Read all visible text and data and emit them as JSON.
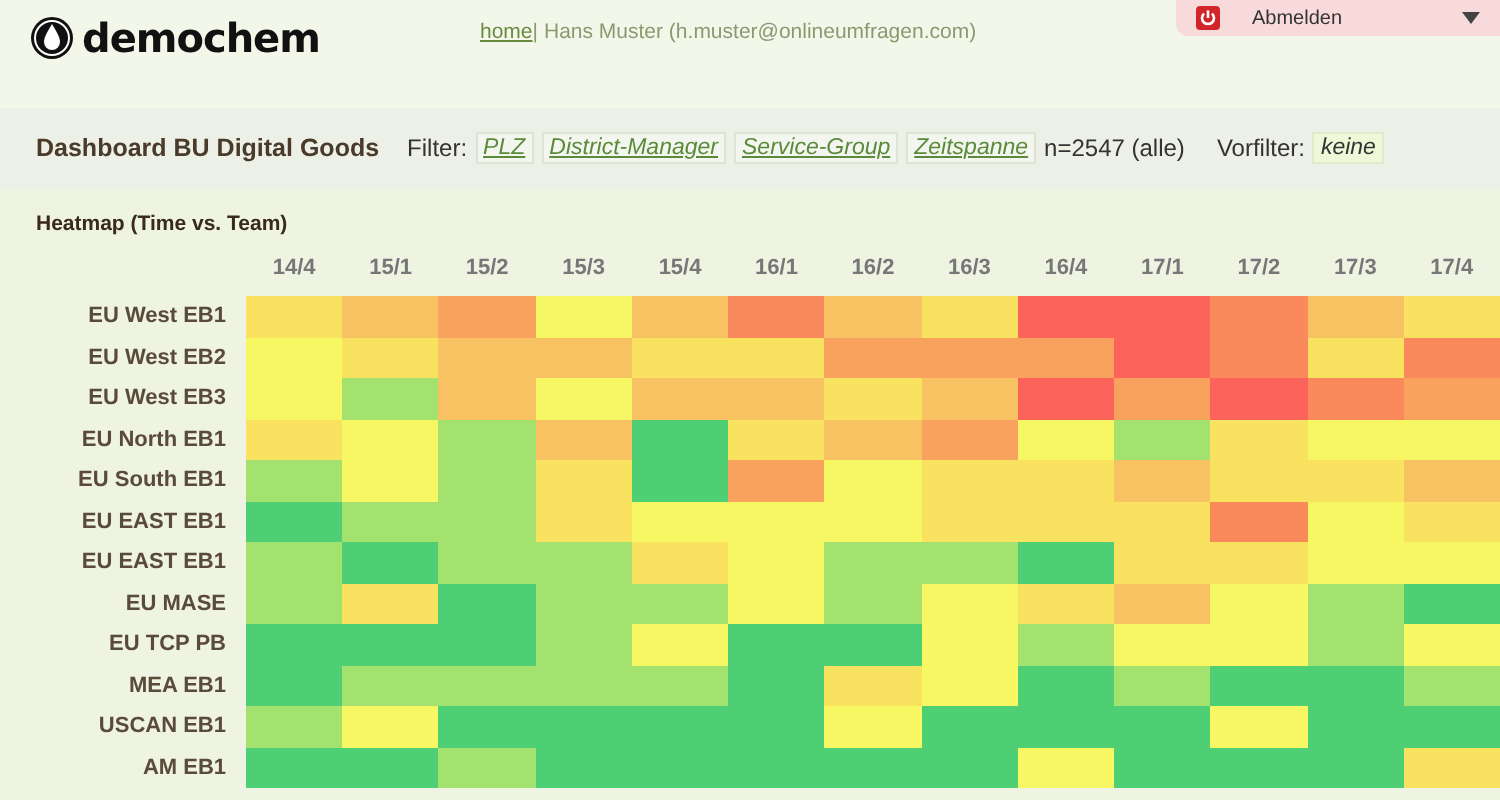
{
  "header": {
    "logo": "demochem",
    "home_link": "home",
    "separator": "|",
    "user": "Hans Muster (h.muster@onlineumfragen.com)",
    "logout": "Abmelden"
  },
  "dashboard": {
    "title": "Dashboard BU Digital Goods",
    "filter_label": "Filter:",
    "filters": [
      "PLZ",
      "District-Manager",
      "Service-Group",
      "Zeitspanne"
    ],
    "count": "n=2547 (alle)",
    "prefilter_label": "Vorfilter:",
    "prefilter": "keine"
  },
  "heatmap": {
    "title": "Heatmap (Time vs. Team)",
    "columns": [
      "14/4",
      "15/1",
      "15/2",
      "15/3",
      "15/4",
      "16/1",
      "16/2",
      "16/3",
      "16/4",
      "17/1",
      "17/2",
      "17/3",
      "17/4"
    ],
    "rows": [
      {
        "label": "EU West EB1",
        "cells": [
          {
            "color": "#f8e25f"
          },
          {
            "color": "#f8c262"
          },
          {
            "color": "#f8a25e"
          },
          {
            "color": "#f7f764"
          },
          {
            "color": "#f8c262"
          },
          {
            "color": "#fa8a5c"
          },
          {
            "color": "#f8c262"
          },
          {
            "color": "#f8e25f"
          },
          {
            "color": "#fc635a"
          },
          {
            "color": "#fc635a"
          },
          {
            "color": "#fa8a5c"
          },
          {
            "color": "#f8c262"
          },
          {
            "color": "#f8e25f"
          }
        ]
      },
      {
        "label": "EU West EB2",
        "cells": [
          {
            "color": "#f7f764"
          },
          {
            "color": "#f8e25f"
          },
          {
            "color": "#f8c262"
          },
          {
            "color": "#f8c262"
          },
          {
            "color": "#f8e25f"
          },
          {
            "color": "#f8e25f"
          },
          {
            "color": "#f8a25e"
          },
          {
            "color": "#f8a25e"
          },
          {
            "color": "#f8a25e"
          },
          {
            "color": "#fc635a"
          },
          {
            "color": "#fa8a5c"
          },
          {
            "color": "#f8e25f"
          },
          {
            "color": "#fa8a5c"
          }
        ]
      },
      {
        "label": "EU West EB3",
        "cells": [
          {
            "color": "#f7f764"
          },
          {
            "color": "#a3e26e"
          },
          {
            "color": "#f8c262"
          },
          {
            "color": "#f7f764"
          },
          {
            "color": "#f8c262"
          },
          {
            "color": "#f8c262"
          },
          {
            "color": "#f8e25f"
          },
          {
            "color": "#f8c262"
          },
          {
            "color": "#fc635a"
          },
          {
            "color": "#f8a25e"
          },
          {
            "color": "#fc635a"
          },
          {
            "color": "#fa8a5c"
          },
          {
            "color": "#f8a25e"
          }
        ]
      },
      {
        "label": "EU North EB1",
        "cells": [
          {
            "color": "#f8e25f"
          },
          {
            "color": "#f7f764"
          },
          {
            "color": "#a3e26e"
          },
          {
            "color": "#f8c262"
          },
          {
            "color": "#4ecf73"
          },
          {
            "color": "#f8e25f"
          },
          {
            "color": "#f8c262"
          },
          {
            "color": "#f8a25e"
          },
          {
            "color": "#f7f764"
          },
          {
            "color": "#a3e26e"
          },
          {
            "color": "#f8e25f"
          },
          {
            "color": "#f7f764"
          },
          {
            "color": "#f7f764"
          }
        ]
      },
      {
        "label": "EU South EB1",
        "cells": [
          {
            "color": "#a3e26e"
          },
          {
            "color": "#f7f764"
          },
          {
            "color": "#a3e26e"
          },
          {
            "color": "#f8e25f"
          },
          {
            "color": "#4ecf73"
          },
          {
            "color": "#f8a25e"
          },
          {
            "color": "#f7f764"
          },
          {
            "color": "#f8e25f"
          },
          {
            "color": "#f8e25f"
          },
          {
            "color": "#f8c262"
          },
          {
            "color": "#f8e25f"
          },
          {
            "color": "#f8e25f"
          },
          {
            "color": "#f8c262"
          }
        ]
      },
      {
        "label": "EU EAST EB1",
        "cells": [
          {
            "color": "#4ecf73"
          },
          {
            "color": "#a3e26e"
          },
          {
            "color": "#a3e26e"
          },
          {
            "color": "#f8e25f"
          },
          {
            "color": "#f7f764"
          },
          {
            "color": "#f7f764"
          },
          {
            "color": "#f7f764"
          },
          {
            "color": "#f8e25f"
          },
          {
            "color": "#f8e25f"
          },
          {
            "color": "#f8e25f"
          },
          {
            "color": "#fa8a5c"
          },
          {
            "color": "#f7f764"
          },
          {
            "color": "#f8e25f"
          }
        ]
      },
      {
        "label": "EU EAST EB1",
        "cells": [
          {
            "color": "#a3e26e"
          },
          {
            "color": "#4ecf73"
          },
          {
            "color": "#a3e26e"
          },
          {
            "color": "#a3e26e"
          },
          {
            "color": "#f8e25f"
          },
          {
            "color": "#f7f764"
          },
          {
            "color": "#a3e26e"
          },
          {
            "color": "#a3e26e"
          },
          {
            "color": "#4ecf73"
          },
          {
            "color": "#f8e25f"
          },
          {
            "color": "#f8e25f"
          },
          {
            "color": "#f7f764"
          },
          {
            "color": "#f7f764"
          }
        ]
      },
      {
        "label": "EU MASE",
        "cells": [
          {
            "color": "#a3e26e"
          },
          {
            "color": "#f8e25f"
          },
          {
            "color": "#4ecf73"
          },
          {
            "color": "#a3e26e"
          },
          {
            "color": "#a3e26e"
          },
          {
            "color": "#f7f764"
          },
          {
            "color": "#a3e26e"
          },
          {
            "color": "#f7f764"
          },
          {
            "color": "#f8e25f"
          },
          {
            "color": "#f8c262"
          },
          {
            "color": "#f7f764"
          },
          {
            "color": "#a3e26e"
          },
          {
            "color": "#4ecf73"
          }
        ]
      },
      {
        "label": "EU TCP PB",
        "cells": [
          {
            "color": "#4ecf73"
          },
          {
            "color": "#4ecf73"
          },
          {
            "color": "#4ecf73"
          },
          {
            "color": "#a3e26e"
          },
          {
            "color": "#f7f764"
          },
          {
            "color": "#4ecf73"
          },
          {
            "color": "#4ecf73"
          },
          {
            "color": "#f7f764"
          },
          {
            "color": "#a3e26e"
          },
          {
            "color": "#f7f764"
          },
          {
            "color": "#f7f764"
          },
          {
            "color": "#a3e26e"
          },
          {
            "color": "#f7f764"
          }
        ]
      },
      {
        "label": "MEA EB1",
        "cells": [
          {
            "color": "#4ecf73"
          },
          {
            "color": "#a3e26e"
          },
          {
            "color": "#a3e26e"
          },
          {
            "color": "#a3e26e"
          },
          {
            "color": "#a3e26e"
          },
          {
            "color": "#4ecf73"
          },
          {
            "color": "#f8e25f"
          },
          {
            "color": "#f7f764"
          },
          {
            "color": "#4ecf73"
          },
          {
            "color": "#a3e26e"
          },
          {
            "color": "#4ecf73"
          },
          {
            "color": "#4ecf73"
          },
          {
            "color": "#a3e26e"
          }
        ]
      },
      {
        "label": "USCAN EB1",
        "cells": [
          {
            "color": "#a3e26e"
          },
          {
            "color": "#f7f764"
          },
          {
            "color": "#4ecf73"
          },
          {
            "color": "#4ecf73"
          },
          {
            "color": "#4ecf73"
          },
          {
            "color": "#4ecf73"
          },
          {
            "color": "#f7f764"
          },
          {
            "color": "#4ecf73"
          },
          {
            "color": "#4ecf73"
          },
          {
            "color": "#4ecf73"
          },
          {
            "color": "#f7f764"
          },
          {
            "color": "#4ecf73"
          },
          {
            "color": "#4ecf73"
          }
        ]
      },
      {
        "label": "AM EB1",
        "cells": [
          {
            "color": "#4ecf73"
          },
          {
            "color": "#4ecf73"
          },
          {
            "color": "#a3e26e"
          },
          {
            "color": "#4ecf73"
          },
          {
            "color": "#4ecf73"
          },
          {
            "color": "#4ecf73"
          },
          {
            "color": "#4ecf73"
          },
          {
            "color": "#4ecf73"
          },
          {
            "color": "#f7f764"
          },
          {
            "color": "#4ecf73"
          },
          {
            "color": "#4ecf73"
          },
          {
            "color": "#4ecf73"
          },
          {
            "color": "#f8e25f"
          }
        ]
      }
    ]
  }
}
